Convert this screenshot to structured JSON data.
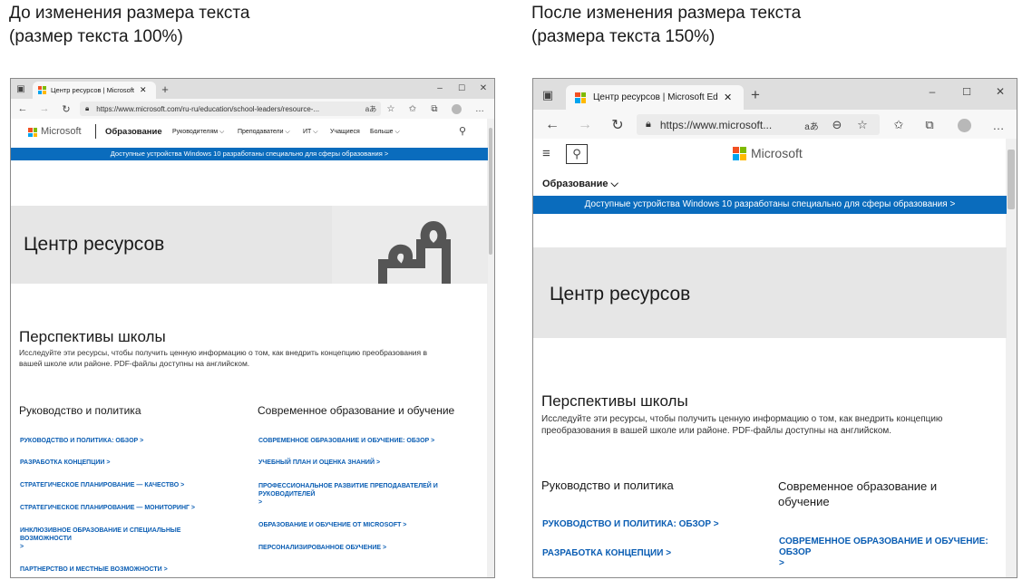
{
  "captions": {
    "left": {
      "line1": "До изменения размера текста",
      "line2": "(размер текста 100%)"
    },
    "right": {
      "line1": "После изменения размера текста",
      "line2": "(размера текста 150%)"
    }
  },
  "left_browser": {
    "tab_title": "Центр ресурсов | Microsoft Edu",
    "url": "https://www.microsoft.com/ru-ru/education/school-leaders/resource-...",
    "nav": {
      "brand": "Microsoft",
      "section": "Образование",
      "items": [
        "Руководителям ⌵",
        "Преподаватели ⌵",
        "ИТ ⌵",
        "Учащиеся",
        "Больше ⌵"
      ]
    },
    "banner": "Доступные устройства Windows 10 разработаны специально для сферы образования >",
    "hero_title": "Центр ресурсов",
    "section_title": "Перспективы школы",
    "section_desc1": "Исследуйте эти ресурсы, чтобы получить ценную информацию о том, как внедрить концепцию преобразования в",
    "section_desc2": "вашей школе или районе. PDF-файлы доступны на английском.",
    "col1_title": "Руководство и политика",
    "col2_title": "Современное образование и обучение",
    "col1_links": [
      "Руководство и политика: обзор >",
      "Разработка концепции >",
      "Стратегическое планирование — качество >",
      "Стратегическое планирование — мониторинг >"
    ],
    "col1_link5_a": "Инклюзивное образование и специальные",
    "col1_link5_b": "возможности",
    "col1_link6": "Партнерство и местные возможности >",
    "col2_links": [
      "Современное образование и обучение: обзор >",
      "Учебный план и оценка знаний >"
    ],
    "col2_link3_a": "Профессиональное развитие преподавателей и",
    "col2_link3_b": "руководителей",
    "col2_link4": "Образование и обучение от Microsoft >",
    "col2_link5": "Персонализированное обучение >"
  },
  "right_browser": {
    "tab_title": "Центр ресурсов | Microsoft Edu",
    "url": "https://www.microsoft...",
    "brand": "Microsoft",
    "section": "Образование ⌵",
    "banner": "Доступные устройства Windows 10 разработаны специально для сферы образования >",
    "hero_title": "Центр ресурсов",
    "section_title": "Перспективы школы",
    "section_desc1": "Исследуйте эти ресурсы, чтобы получить ценную информацию о том, как внедрить концепцию",
    "section_desc2": "преобразования в вашей школе или районе. PDF-файлы доступны на английском.",
    "col1_title": "Руководство и политика",
    "col2_title_a": "Современное образование и",
    "col2_title_b": "обучение",
    "col1_links": [
      "Руководство и политика: обзор >",
      "Разработка концепции >"
    ],
    "col2_link1_a": "Современное образование и обучение:",
    "col2_link1_b": "обзор"
  }
}
